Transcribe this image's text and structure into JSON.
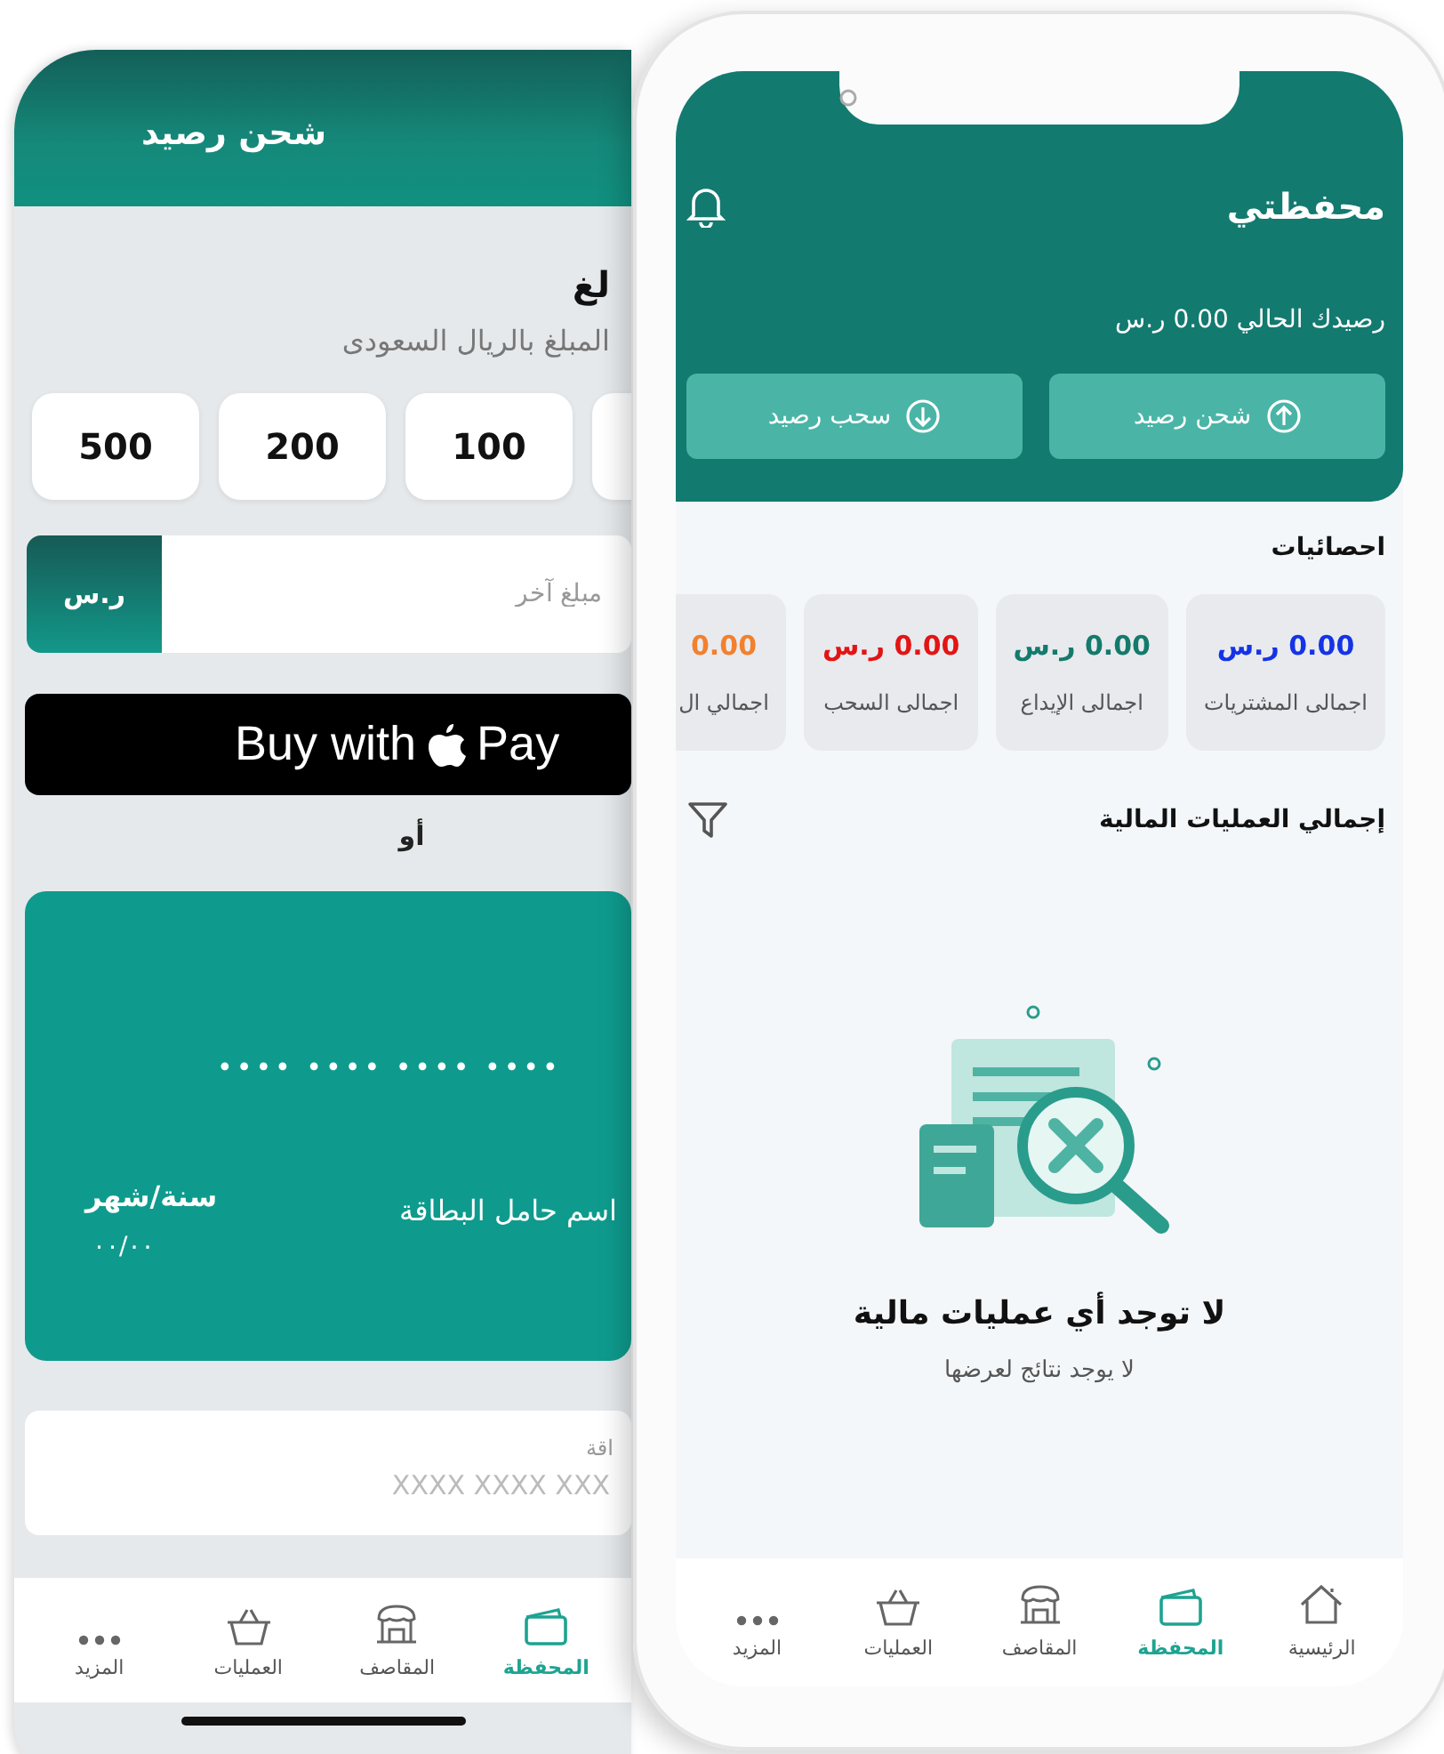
{
  "back_phone": {
    "title": "شحن رصيد",
    "section_title": "لغ",
    "subtitle": "المبلغ بالريال السعودى",
    "amount_chips": [
      "100",
      "200",
      "500"
    ],
    "other_amount": {
      "placeholder": "مبلغ آخر",
      "currency": "ر.س"
    },
    "apple_pay": {
      "text": "Buy with",
      "brand": "Pay"
    },
    "or_label": "أو",
    "card": {
      "number": "•••• •••• •••• ••••",
      "holder": "اسم حامل البطاقة",
      "expiry_label": "سنة/شهر",
      "expiry": "٠٠/٠٠"
    },
    "card_number_field": {
      "label": "اقة",
      "placeholder": "XXXX XXXX XXX"
    },
    "nav": [
      {
        "label": "المحفظة",
        "kind": "wallet",
        "selected": true
      },
      {
        "label": "المقاصف",
        "kind": "store",
        "selected": false
      },
      {
        "label": "العمليات",
        "kind": "basket",
        "selected": false
      },
      {
        "label": "المزيد",
        "kind": "more",
        "selected": false
      }
    ]
  },
  "front_phone": {
    "title": "محفظتي",
    "balance": "رصيدك الحالي 0.00 ر.س",
    "actions": [
      {
        "label": "شحن رصيد",
        "kind": "up"
      },
      {
        "label": "سحب رصيد",
        "kind": "down"
      }
    ],
    "stats_title": "احصائيات",
    "stats": [
      {
        "amount": "0.00 ر.س",
        "label": "اجمالى المشتريات",
        "color": "#1533e6"
      },
      {
        "amount": "0.00 ر.س",
        "label": "اجمالى الإيداع",
        "color": "#137a6c"
      },
      {
        "amount": "0.00 ر.س",
        "label": "اجمالى السحب",
        "color": "#e31414"
      },
      {
        "amount": "0.00",
        "label": "اجمالي ال",
        "color": "#f2802e"
      }
    ],
    "transactions_title": "إجمالي العمليات المالية",
    "empty_title": "لا توجد أي عمليات مالية",
    "empty_subtitle": "لا يوجد نتائج لعرضها",
    "nav": [
      {
        "label": "الرئيسية",
        "kind": "home",
        "selected": false
      },
      {
        "label": "المحفظة",
        "kind": "wallet",
        "selected": true
      },
      {
        "label": "المقاصف",
        "kind": "store",
        "selected": false
      },
      {
        "label": "العمليات",
        "kind": "basket",
        "selected": false
      },
      {
        "label": "المزيد",
        "kind": "more",
        "selected": false
      }
    ]
  }
}
